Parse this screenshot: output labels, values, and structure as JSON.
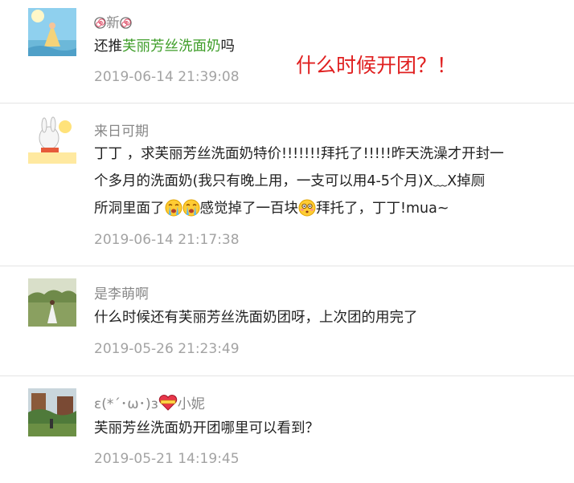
{
  "comments": [
    {
      "name": "新",
      "body_prefix": "还推",
      "body_link": "芙丽芳丝洗面奶",
      "body_suffix": "吗",
      "date": "2019-06-14 21:39:08"
    },
    {
      "name": "来日可期",
      "line1": "丁丁 ，求芙丽芳丝洗面奶特价!!!!!!!拜托了!!!!!昨天洗澡才开封一",
      "line2": "个多月的洗面奶(我只有晚上用，一支可以用4-5个月)X﹏X掉厕",
      "line3_a": "所洞里面了",
      "line3_b": "感觉掉了一百块",
      "line3_c": "拜托了，丁丁!mua~",
      "date": "2019-06-14 21:17:38"
    },
    {
      "name": "是李萌啊",
      "body": "什么时候还有芙丽芳丝洗面奶团呀，上次团的用完了",
      "date": "2019-05-26 21:23:49"
    },
    {
      "name_prefix": "ε(*´･ω･)з",
      "name_suffix": "小妮",
      "body": "芙丽芳丝洗面奶开团哪里可以看到？",
      "date": "2019-05-21 14:19:45"
    }
  ],
  "annotation": "什么时候开团？！",
  "colors": {
    "link": "#3f9e2a",
    "annotation": "#e02020",
    "meta": "#a3a3a3"
  },
  "icons": [
    "spiral-icon",
    "crying-emoji-icon",
    "flushed-emoji-icon",
    "heart-icon"
  ]
}
